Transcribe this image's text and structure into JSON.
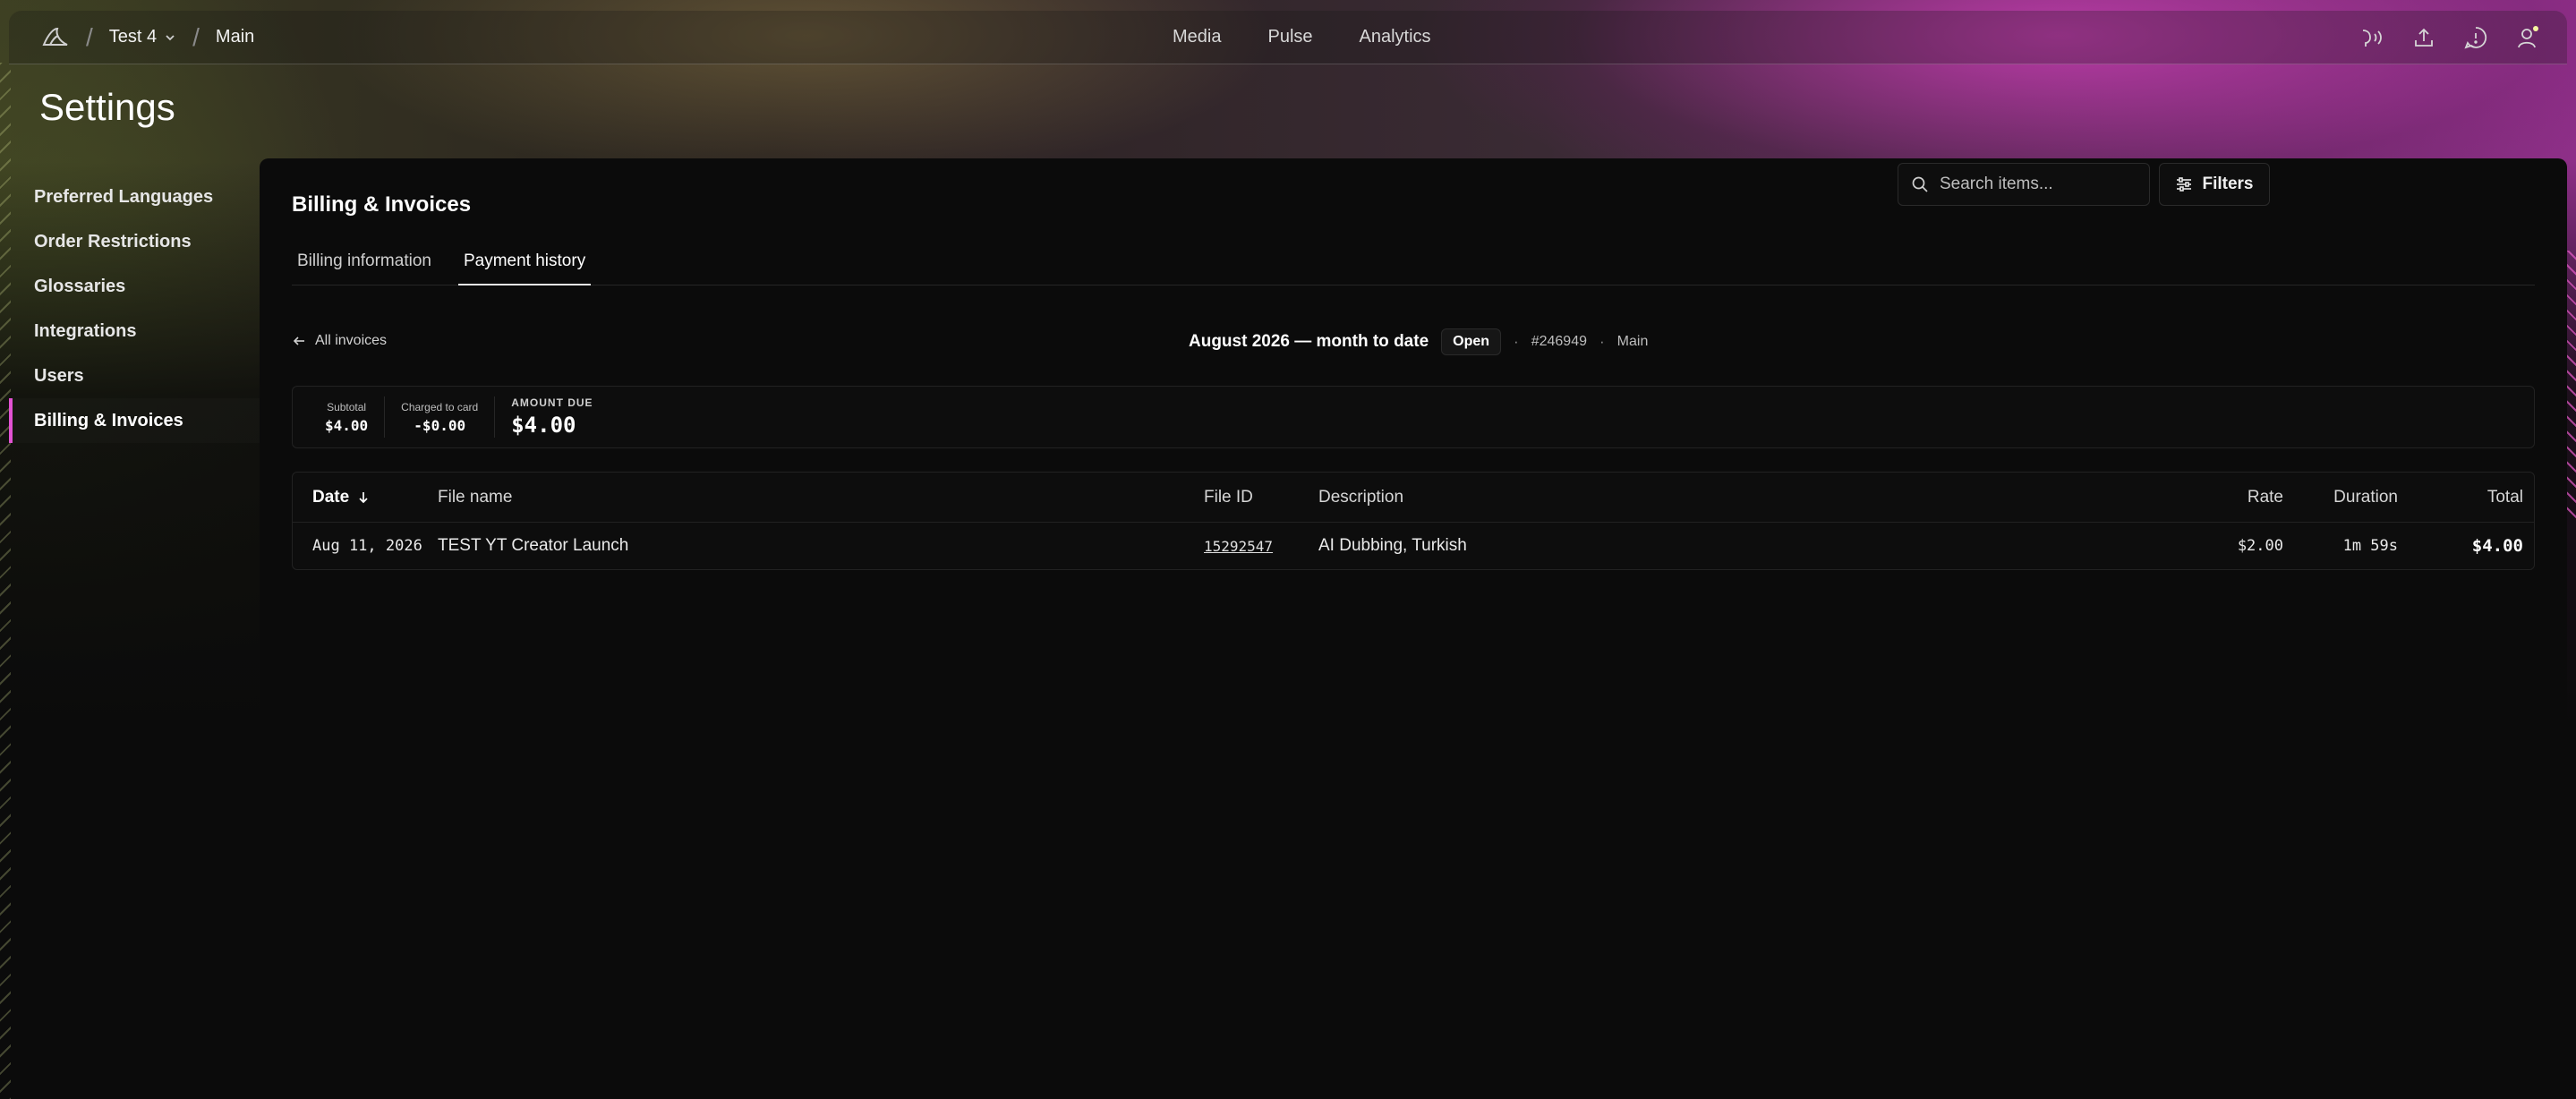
{
  "topbar": {
    "workspace": "Test 4",
    "project": "Main",
    "nav": [
      "Media",
      "Pulse",
      "Analytics"
    ]
  },
  "page": {
    "title": "Settings"
  },
  "sidebar": {
    "items": [
      {
        "label": "Preferred Languages"
      },
      {
        "label": "Order Restrictions"
      },
      {
        "label": "Glossaries"
      },
      {
        "label": "Integrations"
      },
      {
        "label": "Users"
      },
      {
        "label": "Billing & Invoices",
        "active": true
      }
    ]
  },
  "panel": {
    "title": "Billing & Invoices",
    "tabs": [
      {
        "label": "Billing information"
      },
      {
        "label": "Payment history",
        "active": true
      }
    ]
  },
  "invoice": {
    "back_label": "All invoices",
    "period": "August 2026 — month to date",
    "status": "Open",
    "number": "#246949",
    "project": "Main",
    "search_placeholder": "Search items...",
    "filters_label": "Filters"
  },
  "summary": {
    "subtotal_label": "Subtotal",
    "subtotal": "$4.00",
    "charged_label": "Charged to card",
    "charged": "-$0.00",
    "due_label": "AMOUNT DUE",
    "due": "$4.00"
  },
  "table": {
    "headers": {
      "date": "Date",
      "file_name": "File name",
      "file_id": "File ID",
      "description": "Description",
      "rate": "Rate",
      "duration": "Duration",
      "total": "Total"
    },
    "rows": [
      {
        "date": "Aug 11, 2026",
        "file_name": "TEST YT Creator Launch",
        "file_id": "15292547",
        "description": "AI Dubbing, Turkish",
        "rate": "$2.00",
        "duration": "1m 59s",
        "total": "$4.00"
      }
    ]
  },
  "colors": {
    "accent": "#e252d2",
    "panel_bg": "#0b0b0b"
  }
}
